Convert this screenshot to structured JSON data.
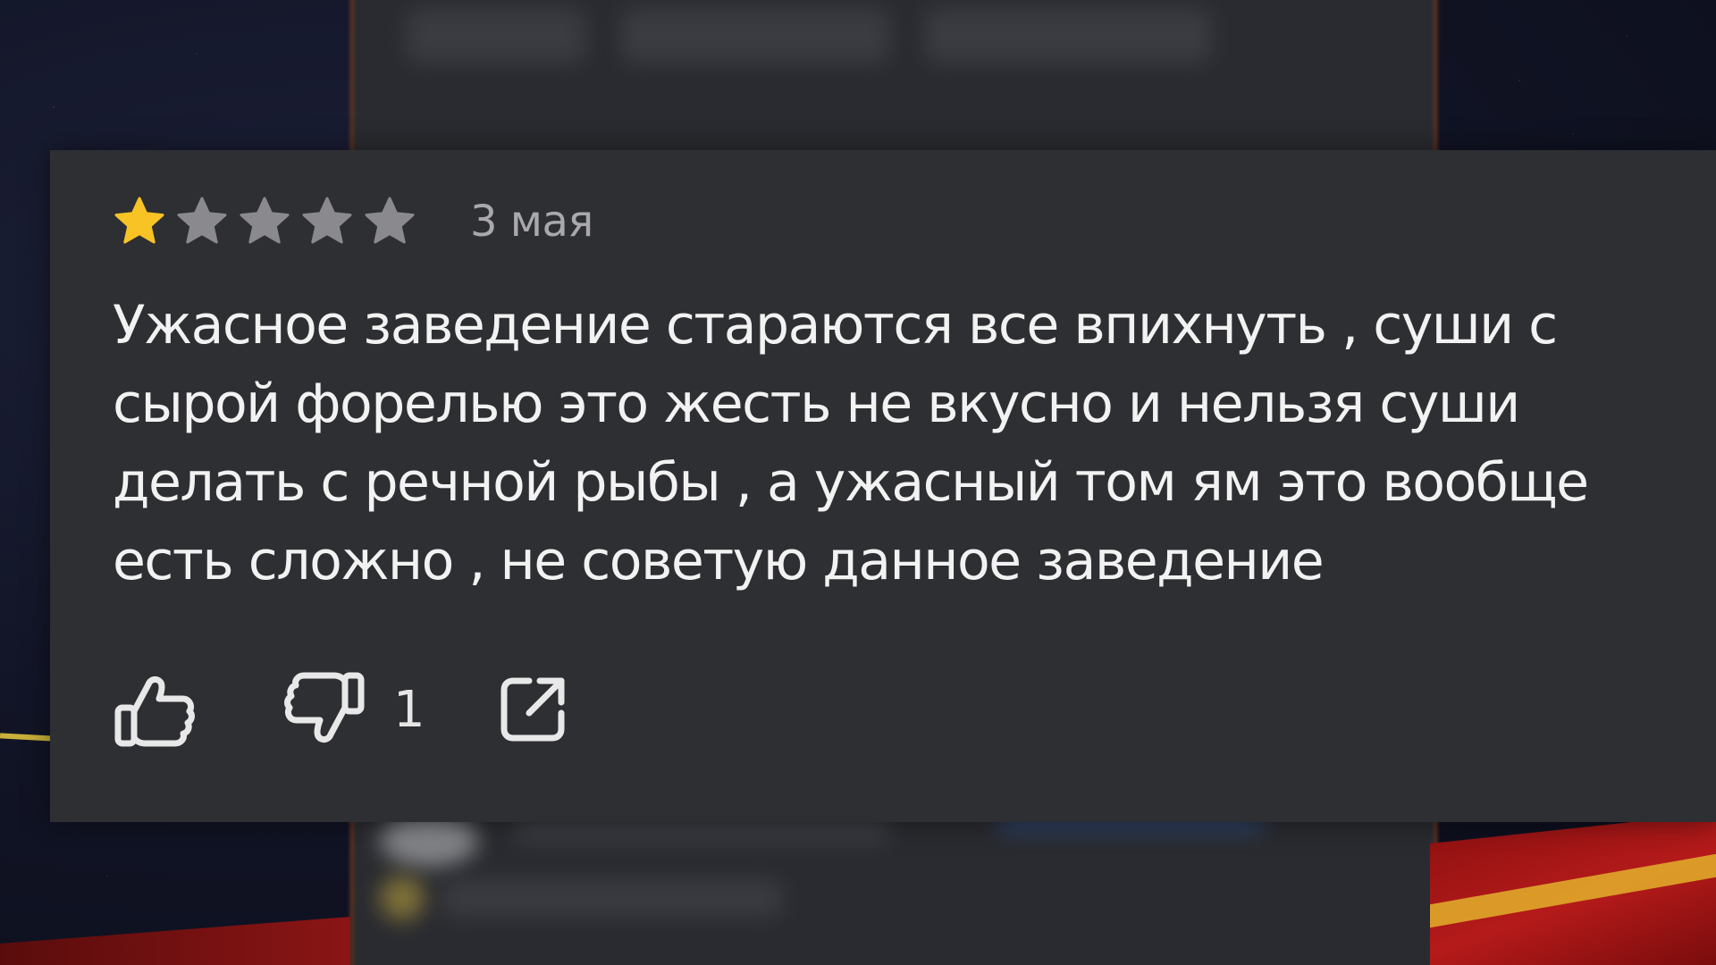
{
  "review": {
    "rating": 1,
    "max_rating": 5,
    "stars": [
      {
        "state": "filled",
        "icon": "star-filled-icon"
      },
      {
        "state": "empty",
        "icon": "star-empty-icon"
      },
      {
        "state": "empty",
        "icon": "star-empty-icon"
      },
      {
        "state": "empty",
        "icon": "star-empty-icon"
      },
      {
        "state": "empty",
        "icon": "star-empty-icon"
      }
    ],
    "date": "3 мая",
    "text": "Ужасное заведение стараются все впихнуть , суши с сырой форелью это жесть не вкусно и нельзя суши делать с речной рыбы , а ужасный том ям это вообще есть сложно , не советую данное заведение",
    "actions": {
      "like_icon": "thumbs-up-icon",
      "dislike_icon": "thumbs-down-icon",
      "dislike_count": "1",
      "share_icon": "share-icon"
    }
  },
  "colors": {
    "card_background": "#2e2f33",
    "star_filled": "#f7c325",
    "star_empty": "#8a8a8e",
    "text_primary": "#f2f2f2",
    "text_secondary": "#a9a9ad"
  }
}
